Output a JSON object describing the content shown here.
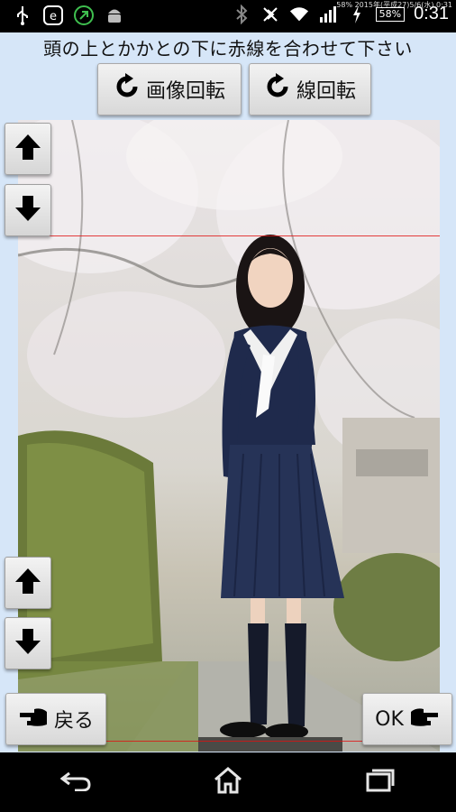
{
  "status_bar": {
    "mini_text": "58% 2015年(平成27)5/6(水) 0:31",
    "battery": "58%",
    "clock": "0:31",
    "icons": [
      "usb-icon",
      "e-badge-icon",
      "upload-icon",
      "android-icon",
      "bluetooth-icon",
      "no-nfc-icon",
      "wifi-icon",
      "signal-icon",
      "charging-icon"
    ]
  },
  "instruction": "頭の上とかかとの下に赤線を合わせて下さい",
  "toolbar": {
    "rotate_image_label": "画像回転",
    "rotate_line_label": "線回転"
  },
  "footer": {
    "back_label": "戻る",
    "ok_label": "OK"
  },
  "colors": {
    "background": "#d6e6f8",
    "guide_line": "#e01010",
    "status_bar": "#000000"
  }
}
